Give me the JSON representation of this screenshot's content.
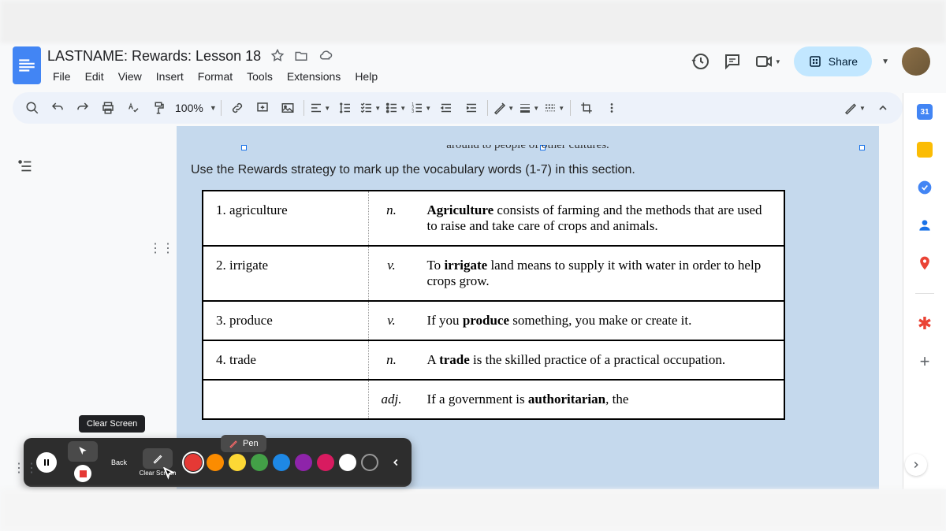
{
  "doc": {
    "title": "LASTNAME: Rewards: Lesson 18"
  },
  "menu": {
    "file": "File",
    "edit": "Edit",
    "view": "View",
    "insert": "Insert",
    "format": "Format",
    "tools": "Tools",
    "extensions": "Extensions",
    "help": "Help"
  },
  "header_actions": {
    "share": "Share"
  },
  "toolbar": {
    "zoom": "100%"
  },
  "content": {
    "prev_line": "around to people of other cultures.",
    "instruction": "Use the Rewards strategy to mark up the vocabulary words (1-7) in this section.",
    "rows": [
      {
        "num": "1. agriculture",
        "pos": "n.",
        "def_pre": "",
        "def_bold": "Agriculture",
        "def_post": " consists of farming and the methods that are used to raise and take care of crops and animals."
      },
      {
        "num": "2. irrigate",
        "pos": "v.",
        "def_pre": "To ",
        "def_bold": "irrigate",
        "def_post": " land means to supply it with water in order to help crops grow."
      },
      {
        "num": "3. produce",
        "pos": "v.",
        "def_pre": "If you ",
        "def_bold": "produce",
        "def_post": " something, you make or create it."
      },
      {
        "num": "4. trade",
        "pos": "n.",
        "def_pre": "A ",
        "def_bold": "trade",
        "def_post": " is the skilled practice of a practical occupation."
      },
      {
        "num": "",
        "pos": "adj.",
        "def_pre": "If a government is ",
        "def_bold": "authoritarian",
        "def_post": ", the"
      }
    ]
  },
  "annotation": {
    "tooltip": "Clear Screen",
    "back": "Back",
    "clear": "Clear Screen",
    "pen": "Pen",
    "colors": [
      {
        "hex": "#e53935",
        "selected": true
      },
      {
        "hex": "#fb8c00",
        "selected": false
      },
      {
        "hex": "#fdd835",
        "selected": false
      },
      {
        "hex": "#43a047",
        "selected": false
      },
      {
        "hex": "#1e88e5",
        "selected": false
      },
      {
        "hex": "#8e24aa",
        "selected": false
      },
      {
        "hex": "#d81b60",
        "selected": false
      },
      {
        "hex": "#ffffff",
        "selected": false
      },
      {
        "hex": "transparent",
        "selected": false
      }
    ]
  },
  "side_panel": {
    "calendar_day": "31"
  }
}
